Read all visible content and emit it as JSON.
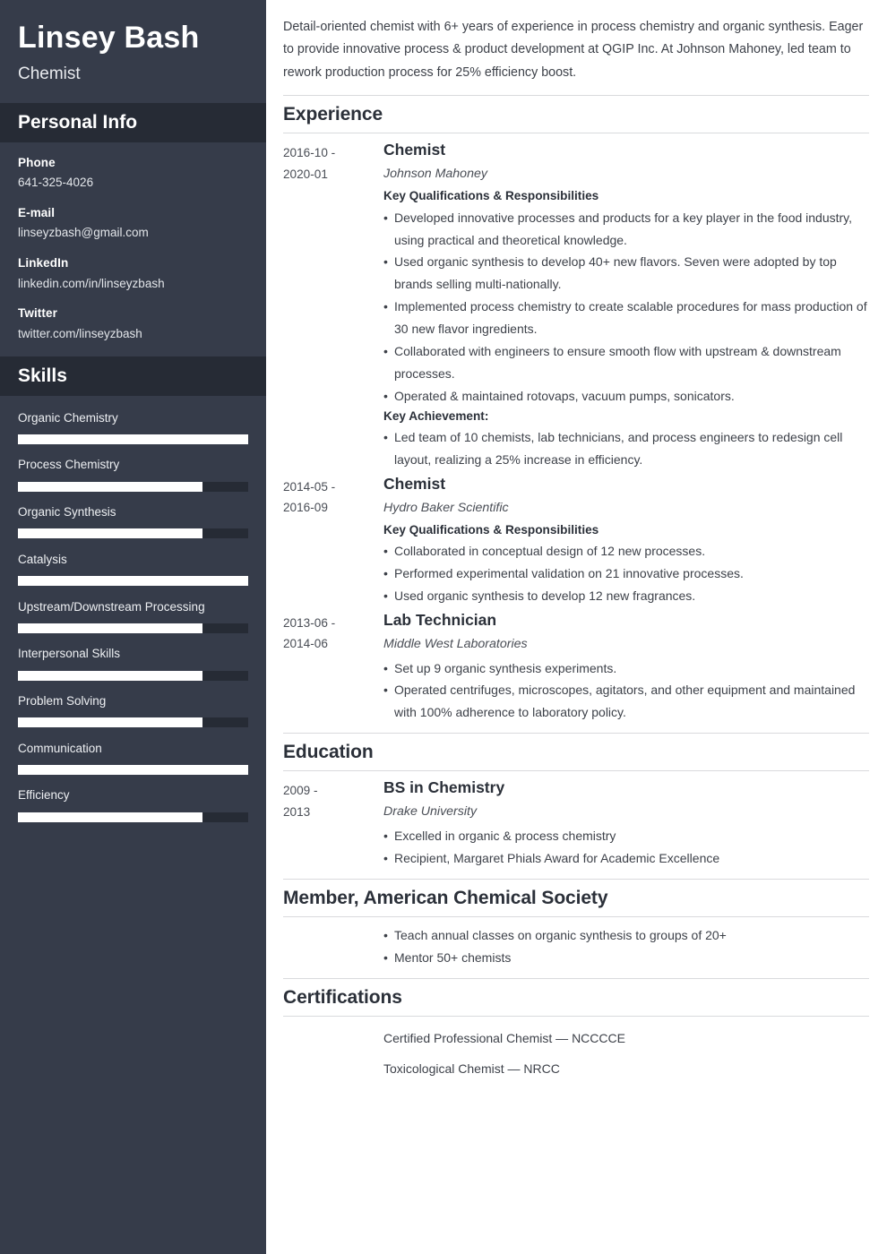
{
  "sidebar": {
    "name": "Linsey Bash",
    "job_title": "Chemist",
    "personal_info_heading": "Personal Info",
    "contacts": [
      {
        "label": "Phone",
        "value": "641-325-4026"
      },
      {
        "label": "E-mail",
        "value": "linseyzbash@gmail.com"
      },
      {
        "label": "LinkedIn",
        "value": "linkedin.com/in/linseyzbash"
      },
      {
        "label": "Twitter",
        "value": "twitter.com/linseyzbash"
      }
    ],
    "skills_heading": "Skills",
    "skills": [
      {
        "name": "Organic Chemistry",
        "level": 100
      },
      {
        "name": "Process Chemistry",
        "level": 80
      },
      {
        "name": "Organic Synthesis",
        "level": 80
      },
      {
        "name": "Catalysis",
        "level": 100
      },
      {
        "name": "Upstream/Downstream Processing",
        "level": 80
      },
      {
        "name": "Interpersonal Skills",
        "level": 80
      },
      {
        "name": "Problem Solving",
        "level": 80
      },
      {
        "name": "Communication",
        "level": 100
      },
      {
        "name": "Efficiency",
        "level": 80
      }
    ]
  },
  "main": {
    "summary": "Detail-oriented chemist with 6+ years of experience in process chemistry and organic synthesis. Eager to provide innovative process & product development at QGIP Inc. At Johnson Mahoney, led team to rework production process for 25% efficiency boost.",
    "experience": {
      "heading": "Experience",
      "entries": [
        {
          "date": "2016-10 - 2020-01",
          "title": "Chemist",
          "org": "Johnson Mahoney",
          "subhead": "Key Qualifications & Responsibilities",
          "bullets": [
            "Developed innovative processes and products for a key player in the food industry, using practical and theoretical knowledge.",
            "Used organic synthesis to develop 40+ new flavors. Seven were adopted by top brands selling multi-nationally.",
            "Implemented process chemistry to create scalable procedures for mass production of 30 new flavor ingredients.",
            "Collaborated with engineers to ensure smooth flow with upstream & downstream processes.",
            "Operated & maintained rotovaps, vacuum pumps, sonicators."
          ],
          "subhead2": "Key Achievement:",
          "bullets2": [
            "Led team of 10 chemists, lab technicians, and process engineers to redesign cell layout, realizing a 25% increase in efficiency."
          ]
        },
        {
          "date": "2014-05 - 2016-09",
          "title": "Chemist",
          "org": "Hydro Baker Scientific",
          "subhead": "Key Qualifications & Responsibilities",
          "bullets": [
            "Collaborated in conceptual design of 12 new processes.",
            "Performed experimental validation on 21 innovative processes.",
            "Used organic synthesis to develop 12 new fragrances."
          ],
          "subhead2": "",
          "bullets2": []
        },
        {
          "date": "2013-06 - 2014-06",
          "title": "Lab Technician",
          "org": "Middle West Laboratories",
          "subhead": "",
          "bullets": [
            "Set up 9 organic synthesis experiments.",
            "Operated centrifuges, microscopes, agitators, and other equipment and maintained with 100% adherence to laboratory policy."
          ],
          "subhead2": "",
          "bullets2": []
        }
      ]
    },
    "education": {
      "heading": "Education",
      "entries": [
        {
          "date": "2009 - 2013",
          "title": "BS in Chemistry",
          "org": "Drake University",
          "bullets": [
            "Excelled in organic & process chemistry",
            "Recipient, Margaret Phials Award for Academic Excellence"
          ]
        }
      ]
    },
    "membership": {
      "heading": "Member, American Chemical Society",
      "bullets": [
        "Teach annual classes on organic synthesis to groups of 20+",
        "Mentor 50+ chemists"
      ]
    },
    "certifications": {
      "heading": "Certifications",
      "items": [
        "Certified Professional Chemist — NCCCCE",
        "Toxicological Chemist — NRCC"
      ]
    }
  },
  "colors": {
    "sidebar_bg": "#363c4a",
    "sidebar_band_bg": "#262b35",
    "bar_fill": "#ffffff",
    "heading_text": "#2b3039",
    "body_text": "#3d4149",
    "rule": "#d9dadd"
  }
}
